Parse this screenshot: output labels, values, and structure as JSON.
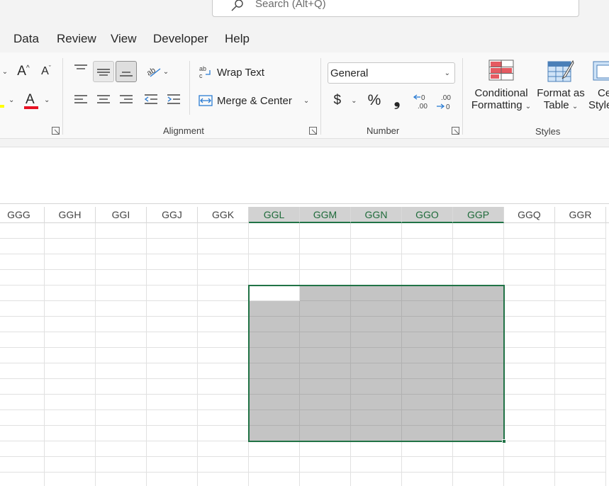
{
  "search": {
    "placeholder": "Search (Alt+Q)"
  },
  "menu": {
    "tabs": [
      {
        "label": "Data"
      },
      {
        "label": "Review"
      },
      {
        "label": "View"
      },
      {
        "label": "Developer"
      },
      {
        "label": "Help"
      }
    ]
  },
  "ribbon": {
    "font": {
      "increase_font_glyph": "A",
      "decrease_font_glyph": "A",
      "font_color_glyph": "A",
      "font_color": "#e81123"
    },
    "alignment": {
      "label": "Alignment",
      "wrap_text": "Wrap Text",
      "merge_center": "Merge & Center"
    },
    "number": {
      "label": "Number",
      "format_value": "General",
      "currency": "$",
      "percent": "%",
      "comma": "❟"
    },
    "styles": {
      "label": "Styles",
      "conditional_formatting_line1": "Conditional",
      "conditional_formatting_line2": "Formatting",
      "format_as_table_line1": "Format as",
      "format_as_table_line2": "Table",
      "cell_styles_line1": "Ce",
      "cell_styles_line2": "Style"
    }
  },
  "sheet": {
    "columns": [
      "GGG",
      "GGH",
      "GGI",
      "GGJ",
      "GGK",
      "GGL",
      "GGM",
      "GGN",
      "GGO",
      "GGP",
      "GGQ",
      "GGR"
    ],
    "selected_columns": [
      "GGL",
      "GGM",
      "GGN",
      "GGO",
      "GGP"
    ],
    "selection_rows": 10,
    "accent": "#217346"
  }
}
